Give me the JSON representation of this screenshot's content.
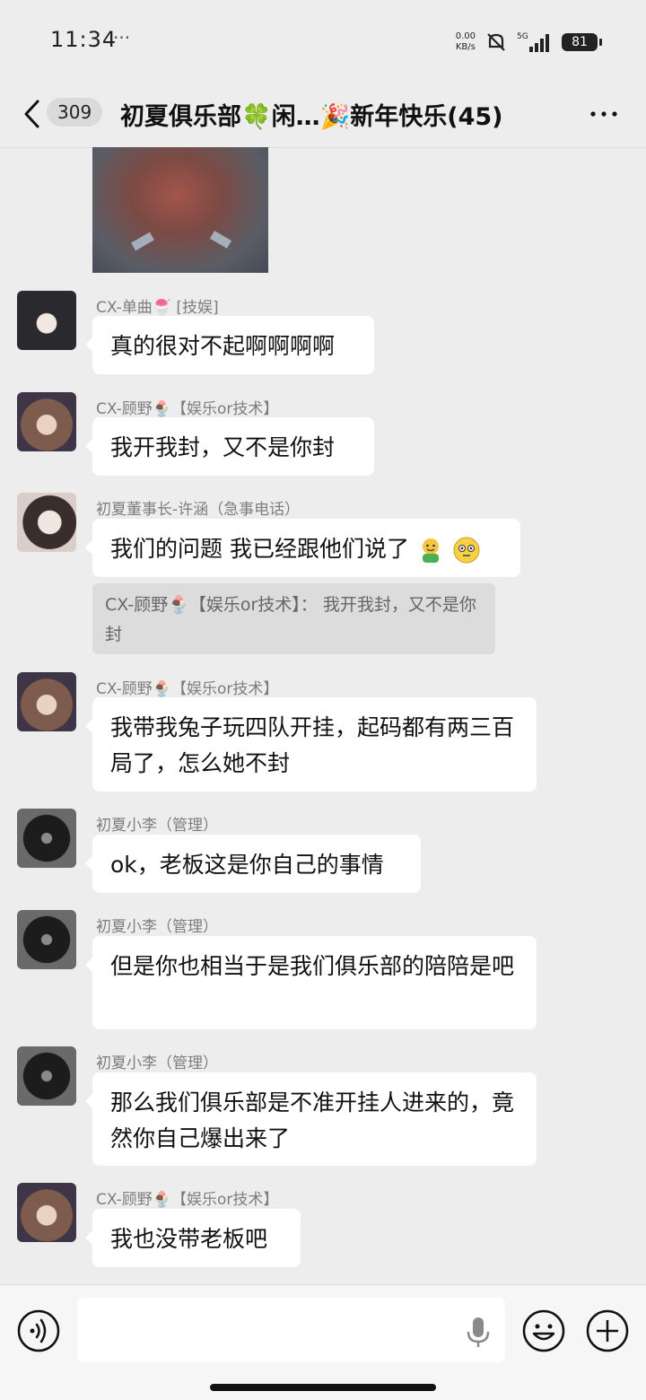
{
  "status_bar": {
    "time": "11:34",
    "dots": "···",
    "net_speed_value": "0.00",
    "net_speed_unit": "KB/s",
    "network": "5G",
    "battery": "81"
  },
  "header": {
    "back_count": "309",
    "title": "初夏俱乐部🍀闲…🎉新年快乐(45)"
  },
  "messages": [
    {
      "sender": "CX-单曲🍧 [技娱]",
      "text": "真的很对不起啊啊啊啊"
    },
    {
      "sender": "CX-顾野🍨【娱乐or技术】",
      "text": "我开我封，又不是你封"
    },
    {
      "sender": "初夏董事长-许涵（急事电话）",
      "text": "我们的问题 我已经跟他们说了",
      "quote": "CX-顾野🍨【娱乐or技术】： 我开我封，又不是你封"
    },
    {
      "sender": "CX-顾野🍨【娱乐or技术】",
      "text": "我带我兔子玩四队开挂，起码都有两三百局了，怎么她不封"
    },
    {
      "sender": "初夏小李（管理）",
      "text": "ok，老板这是你自己的事情"
    },
    {
      "sender": "初夏小李（管理）",
      "text": "但是你也相当于是我们俱乐部的陪陪是吧"
    },
    {
      "sender": "初夏小李（管理）",
      "text": "那么我们俱乐部是不准开挂人进来的，竟然你自己爆出来了"
    },
    {
      "sender": "CX-顾野🍨【娱乐or技术】",
      "text": "我也没带老板吧"
    }
  ],
  "icons": {
    "emoji_1": "hugging-face",
    "emoji_2": "flushed-face"
  },
  "input": {
    "value": "",
    "placeholder": ""
  }
}
